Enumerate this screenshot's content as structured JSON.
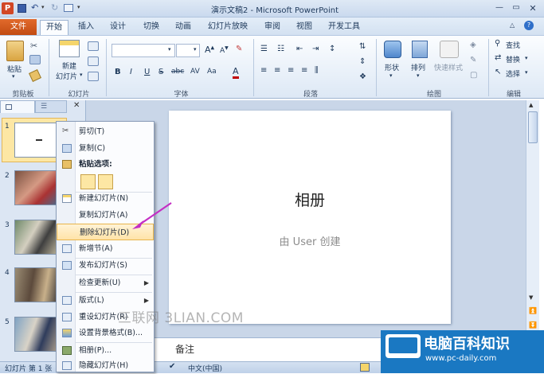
{
  "window": {
    "title": "演示文稿2 - Microsoft PowerPoint",
    "app_icon": "P"
  },
  "tabs": [
    "文件",
    "开始",
    "插入",
    "设计",
    "切换",
    "动画",
    "幻灯片放映",
    "审阅",
    "视图",
    "开发工具"
  ],
  "ribbon": {
    "groups": {
      "clipboard": "剪贴板",
      "slides": "幻灯片",
      "font": "字体",
      "paragraph": "段落",
      "drawing": "绘图",
      "editing": "编辑"
    },
    "paste": "粘贴",
    "new_slide": "新建\n幻灯片",
    "new_slide_line1": "新建",
    "new_slide_line2": "幻灯片",
    "shape": "形状",
    "arrange": "排列",
    "quick_styles": "快速样式",
    "find": "查找",
    "replace": "替换",
    "select": "选择",
    "font_buttons": [
      "B",
      "I",
      "U",
      "S",
      "abc",
      "AV",
      "Aa",
      "A"
    ]
  },
  "slides": [
    {
      "num": "1"
    },
    {
      "num": "2"
    },
    {
      "num": "3"
    },
    {
      "num": "4"
    },
    {
      "num": "5"
    }
  ],
  "slide": {
    "title": "相册",
    "subtitle": "由 User 创建"
  },
  "context_menu": {
    "items": [
      {
        "label": "剪切(T)",
        "icon": "scissors-icon"
      },
      {
        "label": "复制(C)",
        "icon": "copy-icon"
      },
      {
        "label": "粘贴选项:",
        "icon": "paste-icon"
      },
      {
        "label": "新建幻灯片(N)",
        "icon": "new-slide-icon"
      },
      {
        "label": "复制幻灯片(A)",
        "icon": ""
      },
      {
        "label": "删除幻灯片(D)",
        "icon": ""
      },
      {
        "label": "新增节(A)",
        "icon": "section-icon"
      },
      {
        "label": "发布幻灯片(S)",
        "icon": "publish-icon"
      },
      {
        "label": "检查更新(U)",
        "icon": ""
      },
      {
        "label": "版式(L)",
        "icon": "layout-icon"
      },
      {
        "label": "重设幻灯片(R)",
        "icon": "reset-icon"
      },
      {
        "label": "设置背景格式(B)...",
        "icon": "background-icon"
      },
      {
        "label": "相册(P)...",
        "icon": "album-icon"
      },
      {
        "label": "隐藏幻灯片(H)",
        "icon": "hide-icon"
      }
    ]
  },
  "notes_placeholder": "备注",
  "status": {
    "slide_info": "幻灯片 第 1 张",
    "language": "中文(中国)"
  },
  "watermark": {
    "site": "三联网 3LIAN.COM",
    "brand": "电脑百科知识",
    "url": "www.pc-daily.com"
  },
  "colors": {
    "file_tab": "#d15c1c",
    "accent": "#c42fc4",
    "highlight": "#ffe3a8"
  }
}
